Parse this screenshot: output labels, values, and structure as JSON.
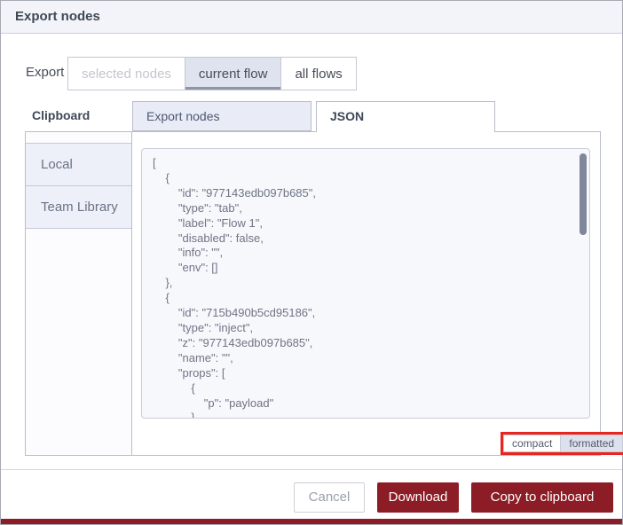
{
  "dialog": {
    "title": "Export nodes",
    "export": {
      "label": "Export",
      "options": [
        {
          "label": "selected nodes",
          "state": "disabled"
        },
        {
          "label": "current flow",
          "state": "selected"
        },
        {
          "label": "all flows",
          "state": "normal"
        }
      ]
    },
    "library": {
      "group_label": "Clipboard",
      "tabs": [
        {
          "label": "Export nodes",
          "active": false
        },
        {
          "label": "JSON",
          "active": true
        }
      ],
      "sidebar_items": [
        {
          "label": "Local"
        },
        {
          "label": "Team Library"
        }
      ]
    },
    "json_view": {
      "content": "[\n    {\n        \"id\": \"977143edb097b685\",\n        \"type\": \"tab\",\n        \"label\": \"Flow 1\",\n        \"disabled\": false,\n        \"info\": \"\",\n        \"env\": []\n    },\n    {\n        \"id\": \"715b490b5cd95186\",\n        \"type\": \"inject\",\n        \"z\": \"977143edb097b685\",\n        \"name\": \"\",\n        \"props\": [\n            {\n                \"p\": \"payload\"\n            },",
      "format_options": [
        {
          "label": "compact",
          "selected": false
        },
        {
          "label": "formatted",
          "selected": true
        }
      ]
    },
    "footer": {
      "cancel_label": "Cancel",
      "download_label": "Download",
      "copy_label": "Copy to clipboard"
    },
    "colors": {
      "accent_maroon": "#8c1c26",
      "annotation_red": "#e8251f",
      "selected_toggle_bg": "#dfe3ef",
      "tab_inactive_bg": "#e9ecf6",
      "code_bg": "#f7f8fc"
    }
  }
}
